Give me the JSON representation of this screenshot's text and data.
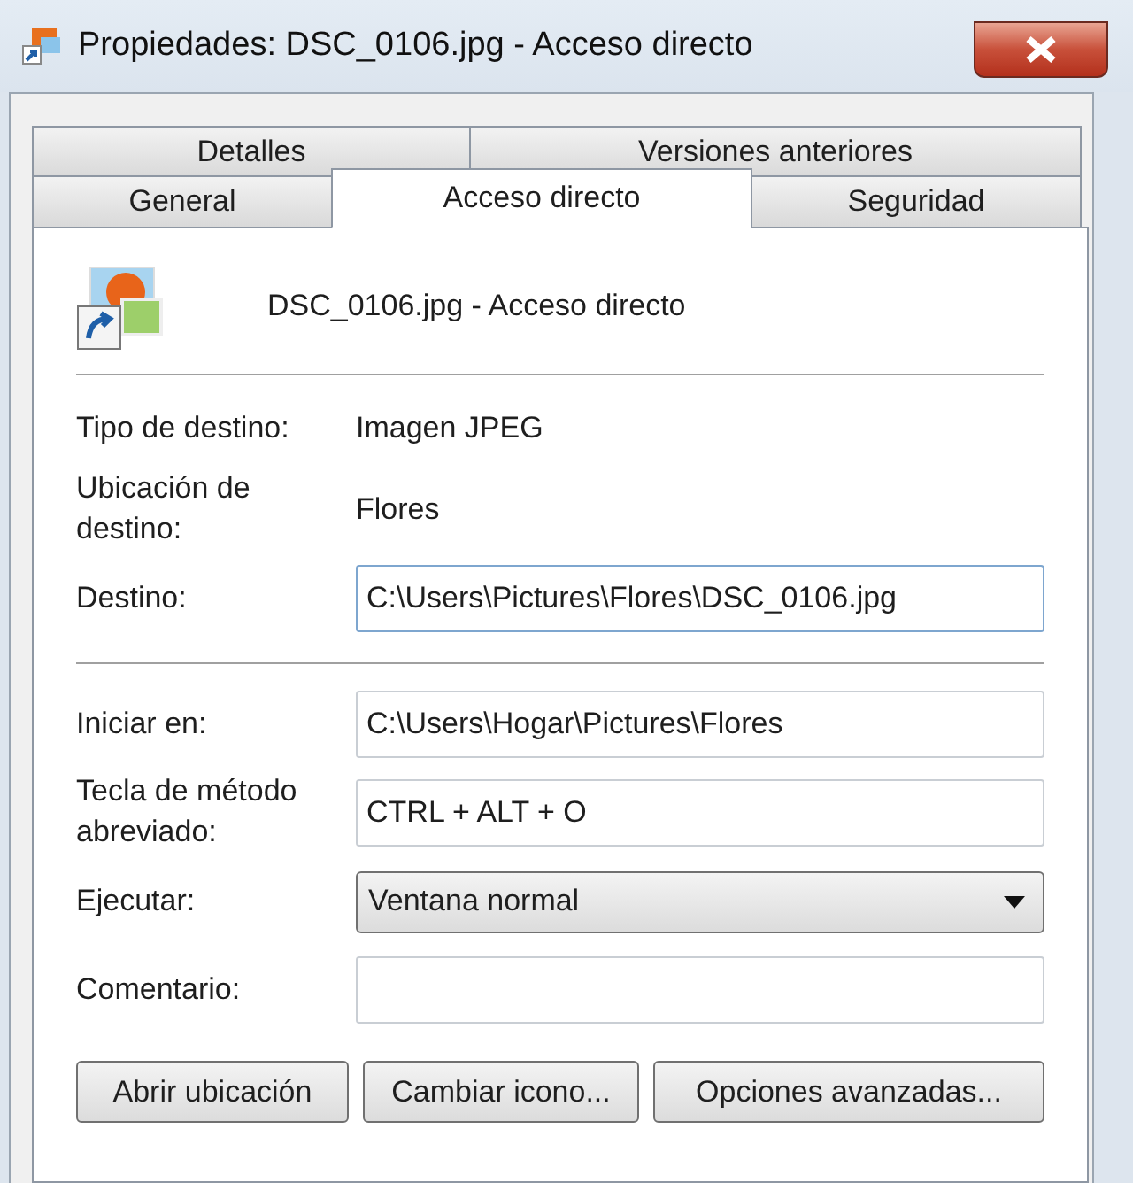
{
  "window": {
    "title": "Propiedades: DSC_0106.jpg - Acceso directo"
  },
  "tab_rows": [
    [
      {
        "label": "Detalles",
        "selected": false
      },
      {
        "label": "Versiones anteriores",
        "selected": false
      }
    ],
    [
      {
        "label": "General",
        "selected": false
      },
      {
        "label": "Acceso directo",
        "selected": true
      },
      {
        "label": "Seguridad",
        "selected": false
      }
    ]
  ],
  "header": {
    "name": "DSC_0106.jpg - Acceso directo"
  },
  "sections": [
    [
      {
        "kind": "text",
        "label": "Tipo de destino:",
        "value": "Imagen JPEG"
      },
      {
        "kind": "text",
        "label": "Ubicación de destino:",
        "value": "Flores"
      },
      {
        "kind": "input",
        "label": "Destino:",
        "value": "C:\\Users\\Pictures\\Flores\\DSC_0106.jpg",
        "focused": true
      }
    ],
    [
      {
        "kind": "input",
        "label": "Iniciar en:",
        "value": "C:\\Users\\Hogar\\Pictures\\Flores",
        "focused": false
      },
      {
        "kind": "input",
        "label": "Tecla de método abreviado:",
        "value": "CTRL + ALT + O",
        "focused": false
      },
      {
        "kind": "select",
        "label": "Ejecutar:",
        "value": "Ventana normal"
      },
      {
        "kind": "input",
        "label": "Comentario:",
        "focused": false
      }
    ]
  ],
  "buttons": [
    "Abrir ubicación",
    "Cambiar icono...",
    "Opciones avanzadas..."
  ]
}
